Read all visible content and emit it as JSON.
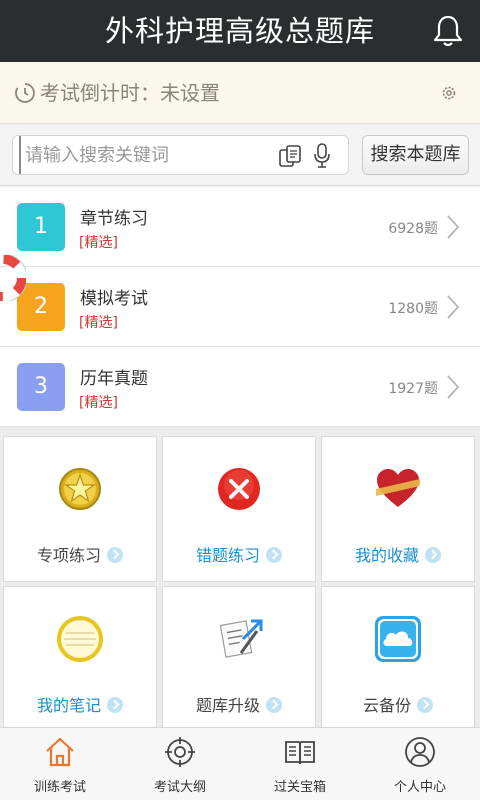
{
  "header": {
    "title": "外科护理高级总题库",
    "bell_icon": "bell-icon"
  },
  "countdown": {
    "label": "考试倒计时：未设置",
    "clock_icon": "clock-icon",
    "settings_icon": "gear-icon"
  },
  "search": {
    "placeholder": "请输入搜索关键词",
    "value": "",
    "button_label": "搜索本题库",
    "scan_icon": "scan-icon",
    "mic_icon": "microphone-icon"
  },
  "sections": [
    {
      "number": "1",
      "name": "章节练习",
      "tag": "[精选]",
      "count": "6928题",
      "color": "#2ec7d6"
    },
    {
      "number": "2",
      "name": "模拟考试",
      "tag": "[精选]",
      "count": "1280题",
      "color": "#f7a51f"
    },
    {
      "number": "3",
      "name": "历年真题",
      "tag": "[精选]",
      "count": "1927题",
      "color": "#8b9ff2"
    }
  ],
  "tools": [
    {
      "label": "专项练习",
      "icon": "star-badge-icon",
      "color": "#444444"
    },
    {
      "label": "错题练习",
      "icon": "error-x-icon",
      "color": "#1a8fd3"
    },
    {
      "label": "我的收藏",
      "icon": "heart-icon",
      "color": "#1a8fd3"
    },
    {
      "label": "我的笔记",
      "icon": "notepad-icon",
      "color": "#1a8fd3"
    },
    {
      "label": "题库升级",
      "icon": "upgrade-icon",
      "color": "#444444"
    },
    {
      "label": "云备份",
      "icon": "cloud-icon",
      "color": "#444444"
    }
  ],
  "tabs": [
    {
      "label": "训练考试",
      "icon": "home-icon",
      "active": true
    },
    {
      "label": "考试大纲",
      "icon": "target-icon",
      "active": false
    },
    {
      "label": "过关宝箱",
      "icon": "book-icon",
      "active": false
    },
    {
      "label": "个人中心",
      "icon": "user-icon",
      "active": false
    }
  ],
  "accent_color": "#e8772e"
}
